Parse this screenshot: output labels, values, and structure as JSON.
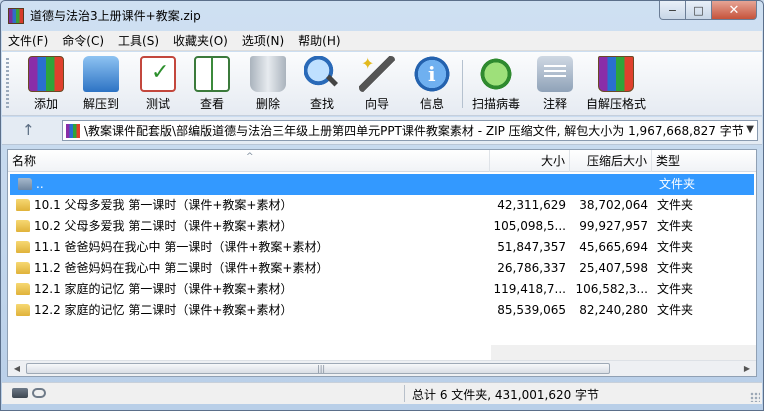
{
  "window": {
    "title": "道德与法治3上册课件+教案.zip",
    "controls": {
      "minimize": "−",
      "maximize": "□",
      "close": "✕"
    }
  },
  "menu": [
    "文件(F)",
    "命令(C)",
    "工具(S)",
    "收藏夹(O)",
    "选项(N)",
    "帮助(H)"
  ],
  "toolbar": [
    {
      "label": "添加",
      "icon": "add-archive-icon"
    },
    {
      "label": "解压到",
      "icon": "extract-folder-icon"
    },
    {
      "label": "测试",
      "icon": "test-checklist-icon"
    },
    {
      "label": "查看",
      "icon": "view-book-icon"
    },
    {
      "label": "删除",
      "icon": "trash-icon"
    },
    {
      "label": "查找",
      "icon": "magnifier-icon"
    },
    {
      "label": "向导",
      "icon": "wizard-wand-icon"
    },
    {
      "label": "信息",
      "icon": "info-icon"
    },
    {
      "label": "扫描病毒",
      "icon": "virus-scan-icon"
    },
    {
      "label": "注释",
      "icon": "comment-icon"
    },
    {
      "label": "自解压格式",
      "icon": "sfx-archive-icon"
    }
  ],
  "address": {
    "up_arrow": "↑",
    "path": "\\教案课件配套版\\部编版道德与法治三年级上册第四单元PPT课件教案素材 - ZIP 压缩文件, 解包大小为 1,967,668,827 字节",
    "dropdown": "▼"
  },
  "columns": {
    "name": "名称",
    "size": "大小",
    "packed": "压缩后大小",
    "type": "类型",
    "sort_indicator": "^"
  },
  "rows": [
    {
      "name": "..",
      "size": "",
      "packed": "",
      "type": "文件夹",
      "selected": true,
      "icon": "folder-up-icon"
    },
    {
      "name": "10.1 父母多爱我  第一课时（课件+教案+素材）",
      "size": "42,311,629",
      "packed": "38,702,064",
      "type": "文件夹",
      "selected": false,
      "icon": "folder-icon"
    },
    {
      "name": "10.2 父母多爱我  第二课时（课件+教案+素材）",
      "size": "105,098,5...",
      "packed": "99,927,957",
      "type": "文件夹",
      "selected": false,
      "icon": "folder-icon"
    },
    {
      "name": "11.1 爸爸妈妈在我心中  第一课时（课件+教案+素材）",
      "size": "51,847,357",
      "packed": "45,665,694",
      "type": "文件夹",
      "selected": false,
      "icon": "folder-icon"
    },
    {
      "name": "11.2 爸爸妈妈在我心中  第二课时（课件+教案+素材）",
      "size": "26,786,337",
      "packed": "25,407,598",
      "type": "文件夹",
      "selected": false,
      "icon": "folder-icon"
    },
    {
      "name": "12.1 家庭的记忆  第一课时（课件+教案+素材）",
      "size": "119,418,7...",
      "packed": "106,582,3...",
      "type": "文件夹",
      "selected": false,
      "icon": "folder-icon"
    },
    {
      "name": "12.2 家庭的记忆  第二课时（课件+教案+素材）",
      "size": "85,539,065",
      "packed": "82,240,280",
      "type": "文件夹",
      "selected": false,
      "icon": "folder-icon"
    }
  ],
  "scrollbar": {
    "left": "◀",
    "right": "▶",
    "grip": "|||"
  },
  "status": {
    "summary": "总计 6 文件夹, 431,001,620 字节"
  },
  "colors": {
    "selection": "#3399ff",
    "chrome": "#c9daec"
  }
}
